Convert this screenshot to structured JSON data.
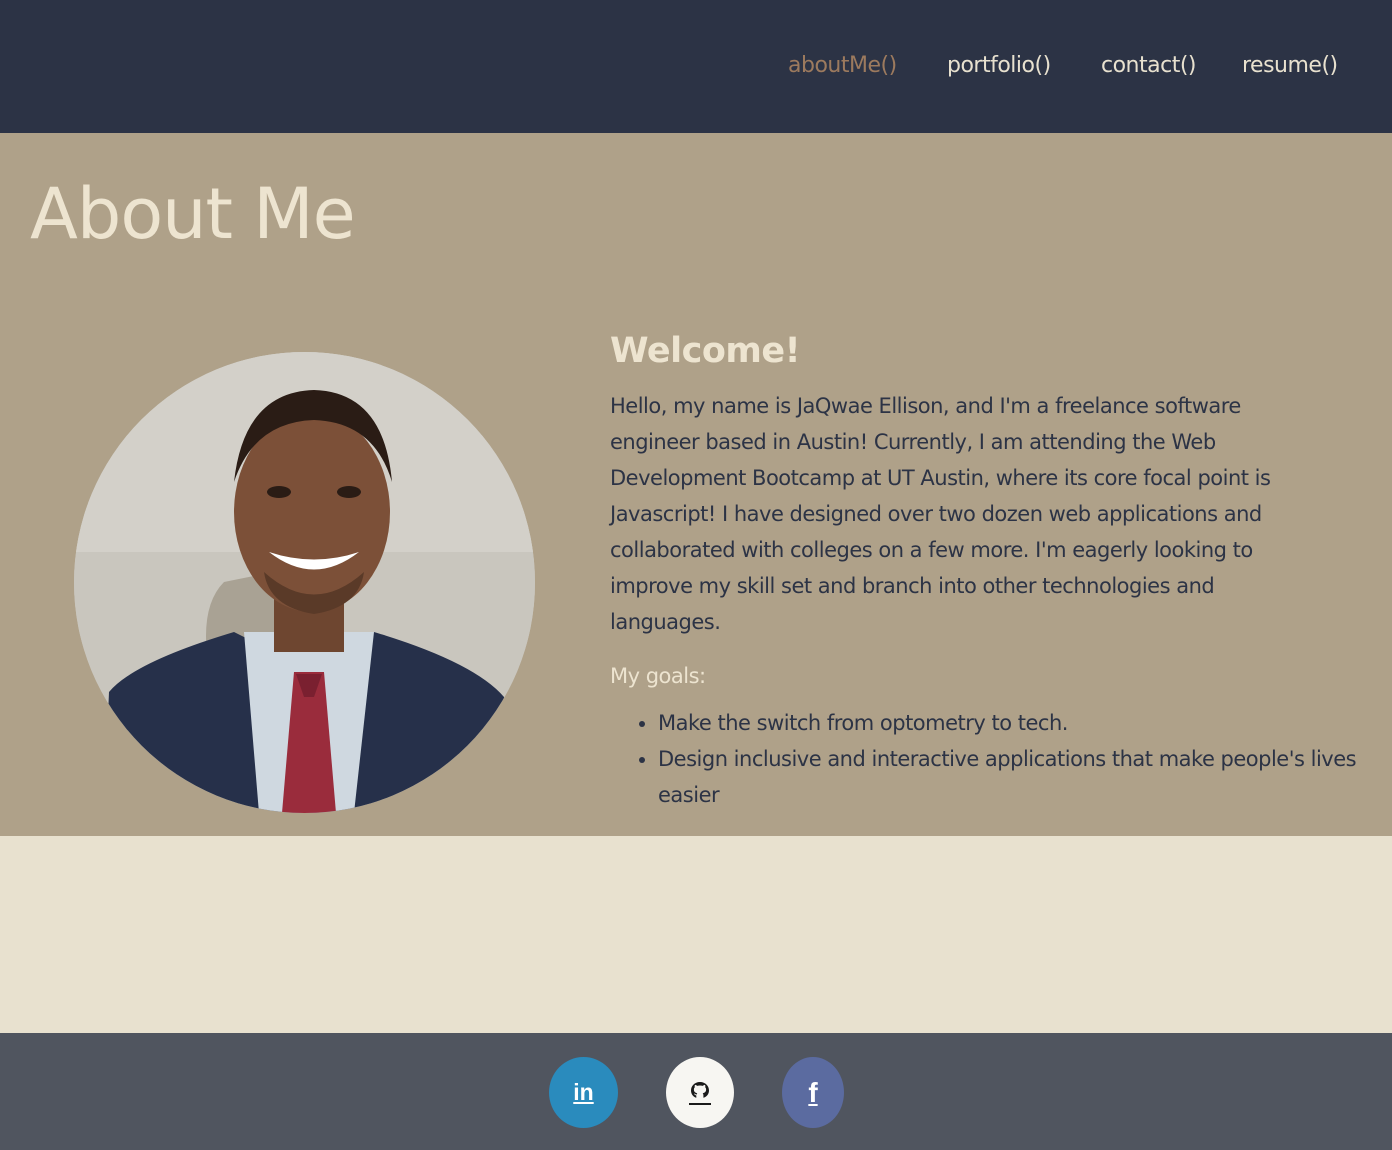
{
  "nav": {
    "items": [
      {
        "label": "aboutMe()",
        "active": true
      },
      {
        "label": "portfolio()",
        "active": false
      },
      {
        "label": "contact()",
        "active": false
      },
      {
        "label": "resume()",
        "active": false
      }
    ]
  },
  "about": {
    "title": "About Me",
    "welcome": "Welcome!",
    "intro": "Hello, my name is JaQwae Ellison, and I'm a freelance software engineer based in Austin! Currently, I am attending the Web Development Bootcamp at UT Austin, where its core focal point is Javascript! I have designed over two dozen web applications and collaborated with colleges on a few more. I'm eagerly looking to improve my skill set and branch into other technologies and languages.",
    "goals_heading": "My goals:",
    "goals": [
      "Make the switch from optometry to tech.",
      "Design inclusive and interactive applications that make people's lives easier"
    ]
  },
  "footer": {
    "social": [
      {
        "icon": "linkedin-icon",
        "glyph": "in",
        "color": "#2a8bbd"
      },
      {
        "icon": "github-icon",
        "glyph": "github",
        "color": "#f7f6f2"
      },
      {
        "icon": "facebook-icon",
        "glyph": "f",
        "color": "#5b6ba0"
      }
    ]
  },
  "colors": {
    "navbar": "#2c3345",
    "about_bg": "#afa189",
    "page_bg": "#e8e1cf",
    "footer": "#50555f",
    "accent_active": "#9c7a5e",
    "light_text": "#ede4d0",
    "dark_text": "#2c3345"
  }
}
